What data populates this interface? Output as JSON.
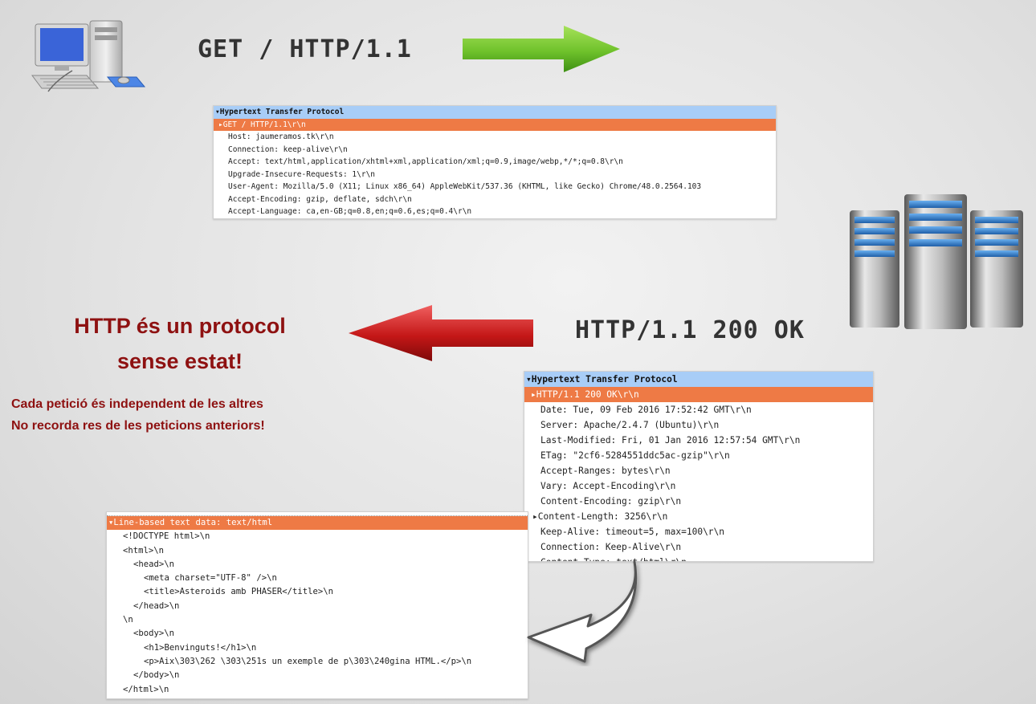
{
  "request": {
    "line": "GET / HTTP/1.1",
    "panel_header": "Hypertext Transfer Protocol",
    "selected": "GET / HTTP/1.1\\r\\n",
    "headers": [
      "Host: jaumeramos.tk\\r\\n",
      "Connection: keep-alive\\r\\n",
      "Accept: text/html,application/xhtml+xml,application/xml;q=0.9,image/webp,*/*;q=0.8\\r\\n",
      "Upgrade-Insecure-Requests: 1\\r\\n",
      "User-Agent: Mozilla/5.0 (X11; Linux x86_64) AppleWebKit/537.36 (KHTML, like Gecko) Chrome/48.0.2564.103",
      "Accept-Encoding: gzip, deflate, sdch\\r\\n",
      "Accept-Language: ca,en-GB;q=0.8,en;q=0.6,es;q=0.4\\r\\n"
    ]
  },
  "response": {
    "line": "HTTP/1.1 200 OK",
    "panel_header": "Hypertext Transfer Protocol",
    "selected": "HTTP/1.1 200 OK\\r\\n",
    "headers": [
      "Date: Tue, 09 Feb 2016 17:52:42 GMT\\r\\n",
      "Server: Apache/2.4.7 (Ubuntu)\\r\\n",
      "Last-Modified: Fri, 01 Jan 2016 12:57:54 GMT\\r\\n",
      "ETag: \"2cf6-5284551ddc5ac-gzip\"\\r\\n",
      "Accept-Ranges: bytes\\r\\n",
      "Vary: Accept-Encoding\\r\\n",
      "Content-Encoding: gzip\\r\\n",
      "Content-Length: 3256\\r\\n",
      "Keep-Alive: timeout=5, max=100\\r\\n",
      "Connection: Keep-Alive\\r\\n",
      "Content-Type: text/html\\r\\n"
    ]
  },
  "body_panel": {
    "header": "Line-based text data: text/html",
    "lines": [
      "<!DOCTYPE html>\\n",
      "<html>\\n",
      "<head>\\n",
      "<meta charset=\"UTF-8\" />\\n",
      "<title>Asteroids amb PHASER</title>\\n",
      "</head>\\n",
      "\\n",
      "<body>\\n",
      "<h1>Benvinguts!</h1>\\n",
      "<p>Aix\\303\\262 \\303\\251s un exemple de p\\303\\240gina HTML.</p>\\n",
      "</body>\\n",
      "</html>\\n"
    ]
  },
  "message": {
    "title_line1": "HTTP és un protocol",
    "title_line2": "sense estat!",
    "sub_line1": "Cada petició és independent de les altres",
    "sub_line2": "No recorda res de les peticions anteriors!"
  },
  "colors": {
    "accent_text": "#8e1111",
    "header_blue": "#a8cdf7",
    "header_orange": "#ee7a45",
    "arrow_green": "#6fc22b",
    "arrow_red": "#c41717"
  }
}
